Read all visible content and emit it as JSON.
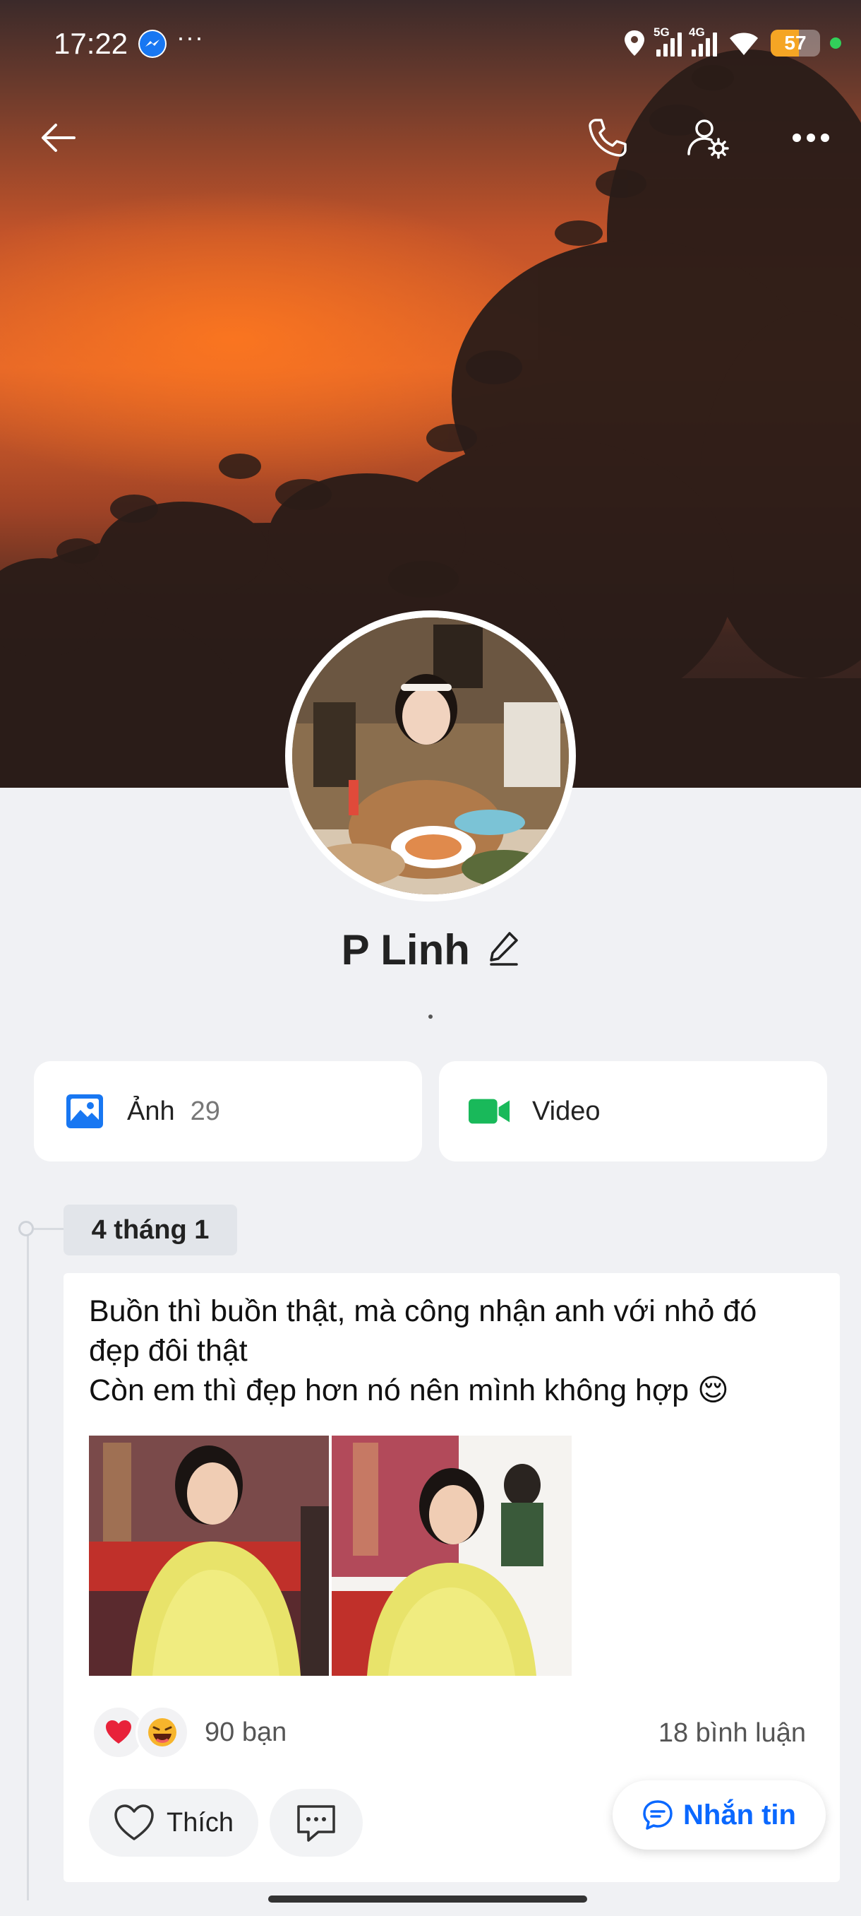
{
  "status_bar": {
    "time": "17:22",
    "signal_1_label": "5G",
    "signal_2_label": "4G",
    "battery": "57",
    "battery_level": 0.57,
    "more": "···"
  },
  "profile": {
    "name": "P Linh",
    "status_text": "."
  },
  "media": {
    "photos_label": "Ảnh",
    "photos_count": "29",
    "video_label": "Video"
  },
  "timeline": {
    "date": "4 tháng 1"
  },
  "post": {
    "text_line_1": "Buồn thì buồn thật, mà công nhận anh với nhỏ đó",
    "text_line_2": "đẹp đôi thật",
    "text_line_3": "Còn em thì đẹp hơn nó nên mình không hợp 😌",
    "reactions": "90 bạn",
    "comments": "18 bình luận",
    "like_label": "Thích"
  },
  "actions": {
    "message_label": "Nhắn tin"
  },
  "colors": {
    "accent": "#0a68ff",
    "photo_icon": "#1877f2",
    "video_icon": "#19b95a",
    "battery": "#f5a524"
  }
}
